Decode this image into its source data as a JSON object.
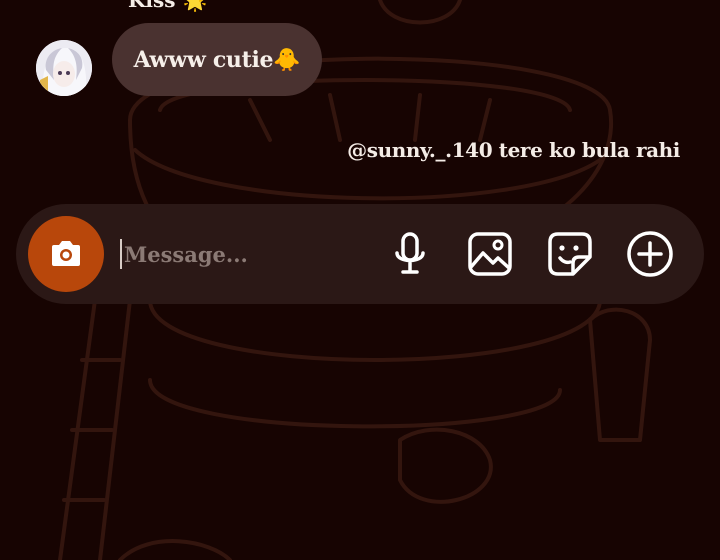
{
  "chat": {
    "partial_message": "Kiss 🌟",
    "received_message": "Awww cutie🐥",
    "mention_message": "@sunny._.140 tere ko bula rahi"
  },
  "composer": {
    "placeholder": "Message...",
    "value": ""
  },
  "icons": {
    "camera": "camera-icon",
    "microphone": "microphone-icon",
    "gallery": "gallery-icon",
    "sticker": "sticker-icon",
    "add": "plus-circle-icon"
  },
  "colors": {
    "background": "#170402",
    "bubble": "#4a3230",
    "composer": "#2b1816",
    "camera_button": "#b8470b",
    "text": "#f4ece6"
  }
}
